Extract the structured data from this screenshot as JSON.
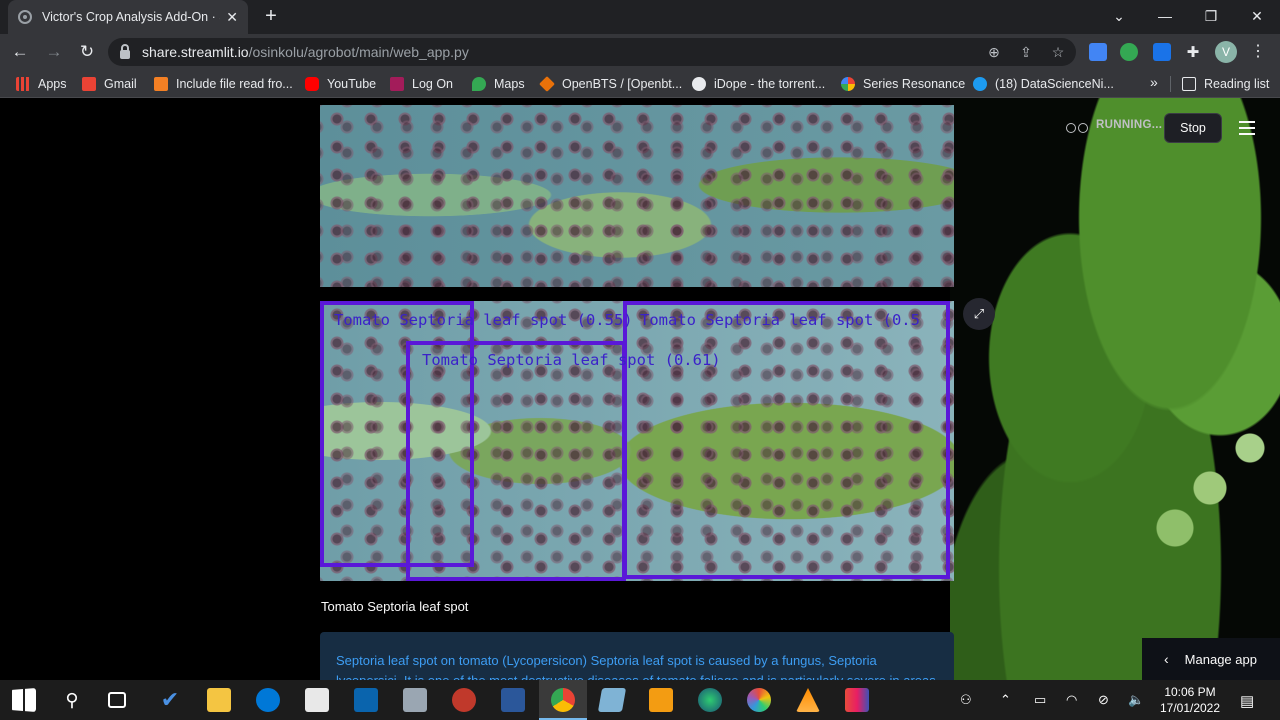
{
  "browser": {
    "tab_title": "Victor's Crop Analysis Add-On · S",
    "tab_close": "✕",
    "new_tab": "+",
    "url_host": "share.streamlit.io",
    "url_path": "/osinkolu/agrobot/main/web_app.py",
    "profile_initial": "V",
    "bookmarks": [
      {
        "label": "Apps",
        "color": "#ea4335"
      },
      {
        "label": "Gmail",
        "color": "#ea4335"
      },
      {
        "label": "Include file read fro...",
        "color": "#f48024"
      },
      {
        "label": "YouTube",
        "color": "#ff0000"
      },
      {
        "label": "Log On",
        "color": "#a31c5a"
      },
      {
        "label": "Maps",
        "color": "#34a853"
      },
      {
        "label": "OpenBTS / [Openbt...",
        "color": "#e8710a"
      },
      {
        "label": "iDope - the torrent...",
        "color": "#e8eaed"
      },
      {
        "label": "Series Resonance",
        "color": "#4285f4"
      },
      {
        "label": "(18) DataScienceNi...",
        "color": "#1d9bf0"
      }
    ],
    "bookmarks_more": "»",
    "reading_list": "Reading list"
  },
  "app": {
    "status_text": "RUNNING...",
    "stop_label": "Stop",
    "detections": [
      {
        "label": "Tomato Septoria leaf spot (0.55)"
      },
      {
        "label": "Tomato Septoria leaf spot (0.61)"
      },
      {
        "label": "Tomato Septoria leaf spot (0.5"
      }
    ],
    "caption": "Tomato Septoria leaf spot",
    "info_text": "Septoria leaf spot on tomato (Lycopersicon) Septoria leaf spot is caused by a fungus, Septoria lycopersici. It is one of the most destructive diseases of tomato foliage and is particularly severe in areas",
    "manage_label": "Manage app",
    "accent_color": "#5a18d8"
  },
  "taskbar": {
    "time": "10:06 PM",
    "date": "17/01/2022"
  }
}
